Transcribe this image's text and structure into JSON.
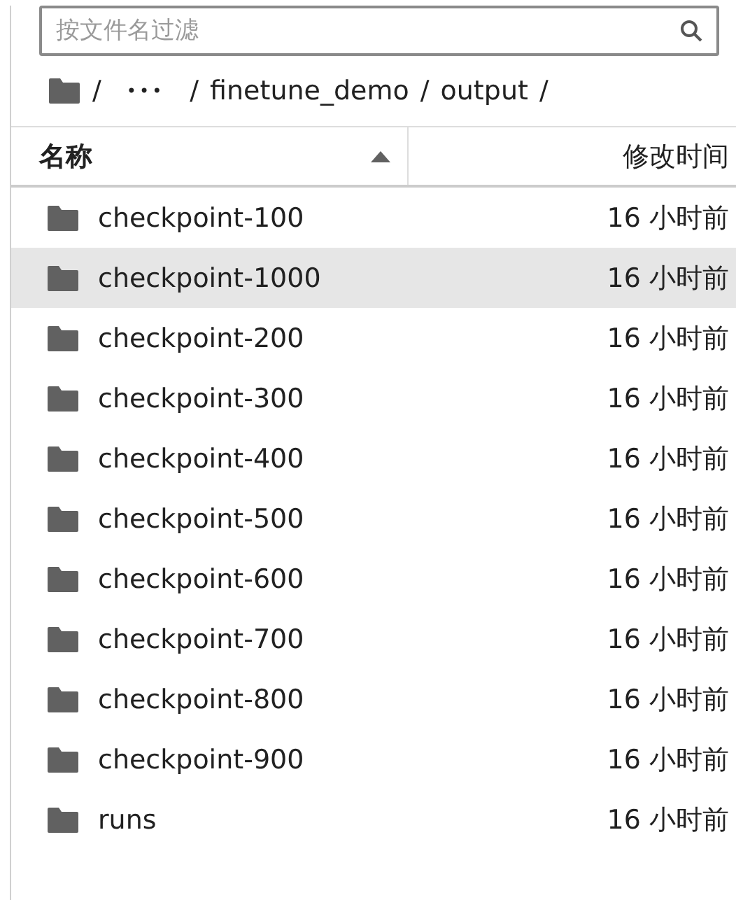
{
  "filter": {
    "placeholder": "按文件名过滤"
  },
  "breadcrumbs": [
    {
      "kind": "home"
    },
    {
      "kind": "sep",
      "text": "/"
    },
    {
      "kind": "more",
      "text": "•••"
    },
    {
      "kind": "sep",
      "text": "/"
    },
    {
      "kind": "dir",
      "text": "finetune_demo"
    },
    {
      "kind": "sep",
      "text": "/"
    },
    {
      "kind": "dir",
      "text": "output"
    },
    {
      "kind": "sep",
      "text": "/"
    }
  ],
  "table": {
    "columns": [
      {
        "label": "名称",
        "sorted": true
      },
      {
        "label": "修改时间",
        "sorted": false
      }
    ],
    "rows": [
      {
        "name": "checkpoint-100",
        "modified": "16 小时前",
        "selected": false
      },
      {
        "name": "checkpoint-1000",
        "modified": "16 小时前",
        "selected": true
      },
      {
        "name": "checkpoint-200",
        "modified": "16 小时前",
        "selected": false
      },
      {
        "name": "checkpoint-300",
        "modified": "16 小时前",
        "selected": false
      },
      {
        "name": "checkpoint-400",
        "modified": "16 小时前",
        "selected": false
      },
      {
        "name": "checkpoint-500",
        "modified": "16 小时前",
        "selected": false
      },
      {
        "name": "checkpoint-600",
        "modified": "16 小时前",
        "selected": false
      },
      {
        "name": "checkpoint-700",
        "modified": "16 小时前",
        "selected": false
      },
      {
        "name": "checkpoint-800",
        "modified": "16 小时前",
        "selected": false
      },
      {
        "name": "checkpoint-900",
        "modified": "16 小时前",
        "selected": false
      },
      {
        "name": "runs",
        "modified": "16 小时前",
        "selected": false
      }
    ]
  }
}
